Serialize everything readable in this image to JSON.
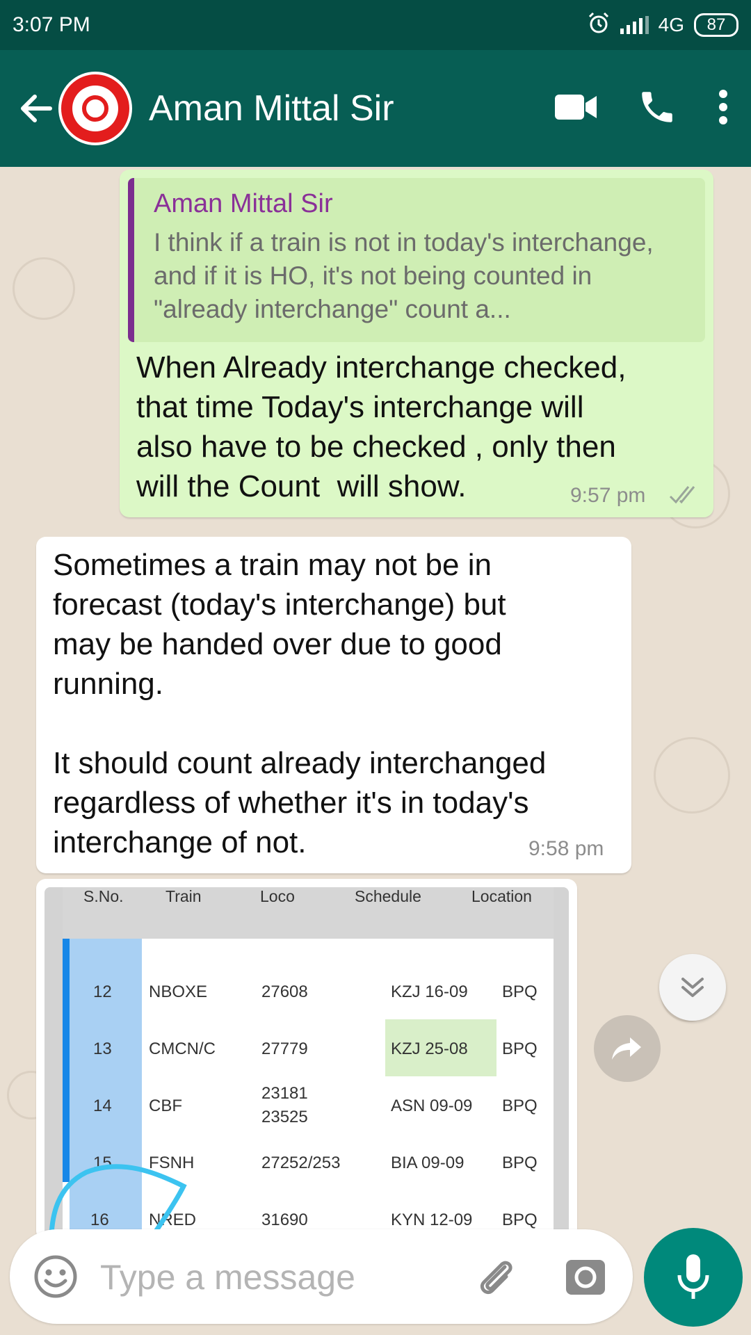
{
  "status_bar": {
    "time": "3:07 PM",
    "network": "4G",
    "battery": "87",
    "icons": [
      "alarm-icon",
      "signal-icon"
    ]
  },
  "header": {
    "contact_name": "Aman Mittal Sir",
    "icons": [
      "back-arrow-icon",
      "video-call-icon",
      "phone-call-icon",
      "more-vert-icon"
    ]
  },
  "messages": [
    {
      "direction": "outgoing",
      "quote": {
        "author": "Aman Mittal Sir",
        "text": "I think if a train is not in today's interchange, and if it is HO, it's not being counted in \"already interchange\" count a..."
      },
      "text": "When Already interchange checked,\nthat time Today's interchange will\nalso have to be checked , only then\nwill the Count  will show.",
      "time": "9:57 pm",
      "status_icon": "double-check-icon"
    },
    {
      "direction": "incoming",
      "text": "Sometimes a train may not be in\nforecast (today's interchange) but\nmay be handed over due to good\nrunning.\n\nIt should count already interchanged\nregardless of whether it's in today's\ninterchange of not.",
      "time": "9:58 pm"
    },
    {
      "direction": "incoming",
      "type": "image",
      "table": {
        "headers": [
          "S.No.",
          "Train",
          "Loco",
          "Schedule",
          "Location"
        ],
        "rows": [
          [
            "12",
            "NBOXE",
            "27608",
            "KZJ 16-09",
            "BPQ"
          ],
          [
            "13",
            "CMCN/C",
            "27779",
            "KZJ 25-08",
            "BPQ"
          ],
          [
            "14",
            "CBF",
            "23181\n23525",
            "ASN 09-09",
            "BPQ"
          ],
          [
            "15",
            "FSNH",
            "27252/253",
            "BIA 09-09",
            "BPQ"
          ],
          [
            "16",
            "NRED",
            "31690",
            "KYN 12-09",
            "BPQ"
          ]
        ],
        "highlighted_cell": "KZJ 25-08"
      }
    }
  ],
  "composer": {
    "placeholder": "Type a message",
    "icons": [
      "emoji-icon",
      "attach-icon",
      "camera-icon",
      "mic-icon"
    ]
  },
  "colors": {
    "status_bar": "#054d44",
    "app_bar": "#075e54",
    "outgoing_bubble": "#dcf8c6",
    "incoming_bubble": "#ffffff",
    "quote_author": "#8a3098",
    "mic_button": "#00897b",
    "chat_background": "#e9dfd2"
  }
}
